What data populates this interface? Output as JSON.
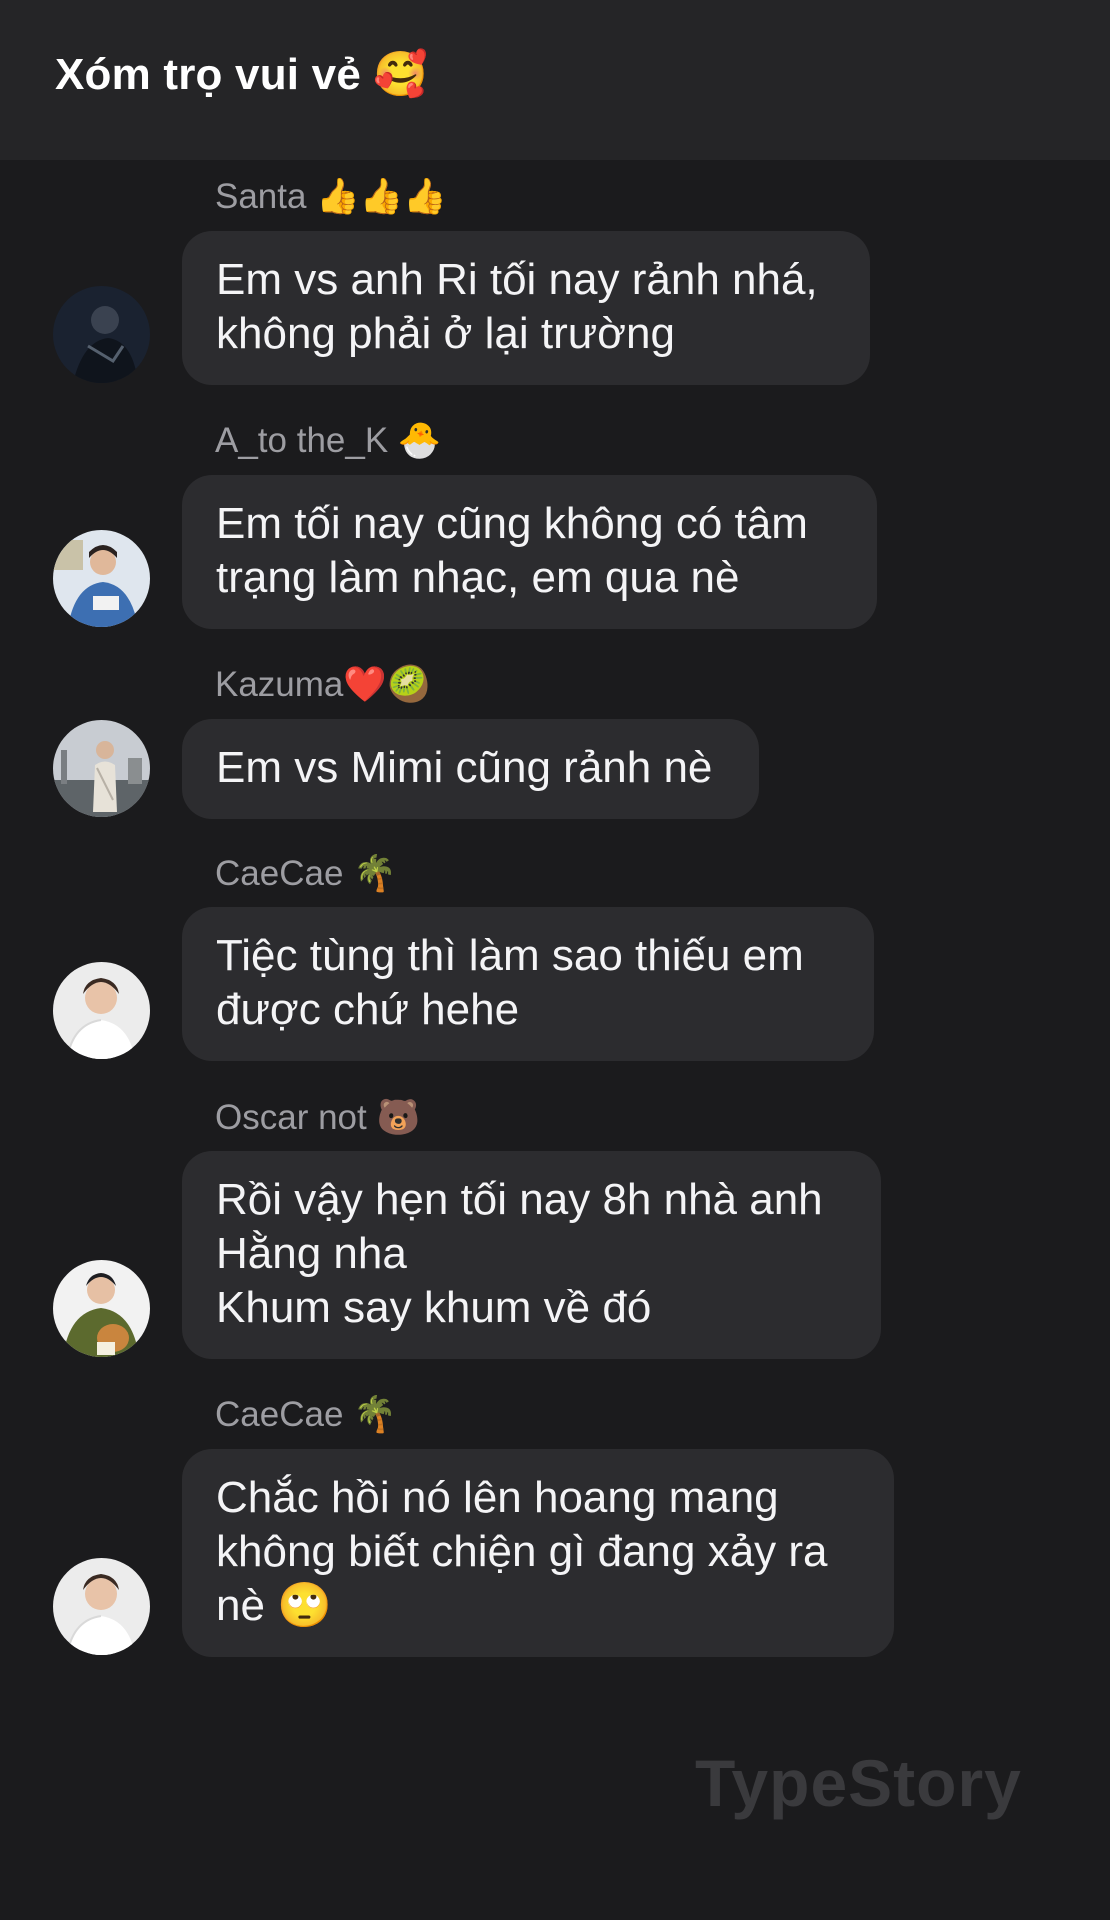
{
  "header": {
    "title": "Xóm trọ vui vẻ 🥰"
  },
  "messages": [
    {
      "sender": "Santa 👍👍👍",
      "lines": [
        "Em vs anh Ri tối nay rảnh nhá,",
        "không phải ở lại trường"
      ]
    },
    {
      "sender": "A_to the_K 🐣",
      "lines": [
        "Em tối nay cũng không có tâm",
        "trạng làm nhạc, em qua nè"
      ]
    },
    {
      "sender": "Kazuma❤️🥝",
      "lines": [
        "Em vs Mimi cũng rảnh nè"
      ]
    },
    {
      "sender": "CaeCae 🌴",
      "lines": [
        "Tiệc tùng thì làm sao thiếu em",
        "được chứ hehe"
      ]
    },
    {
      "sender": "Oscar not 🐻",
      "lines": [
        "Rồi vậy hẹn tối nay 8h nhà anh",
        "Hằng nha",
        "Khum say khum về đó"
      ]
    },
    {
      "sender": "CaeCae 🌴",
      "lines": [
        "Chắc hồi nó lên hoang mang",
        "không biết chiện gì đang xảy ra",
        "nè 🙄"
      ]
    }
  ],
  "watermark": "TypeStory",
  "colors": {
    "background": "#1b1b1d",
    "header": "#252527",
    "bubble": "#2c2c2f",
    "sender": "#9d9da2",
    "text": "#f4f4f6"
  }
}
